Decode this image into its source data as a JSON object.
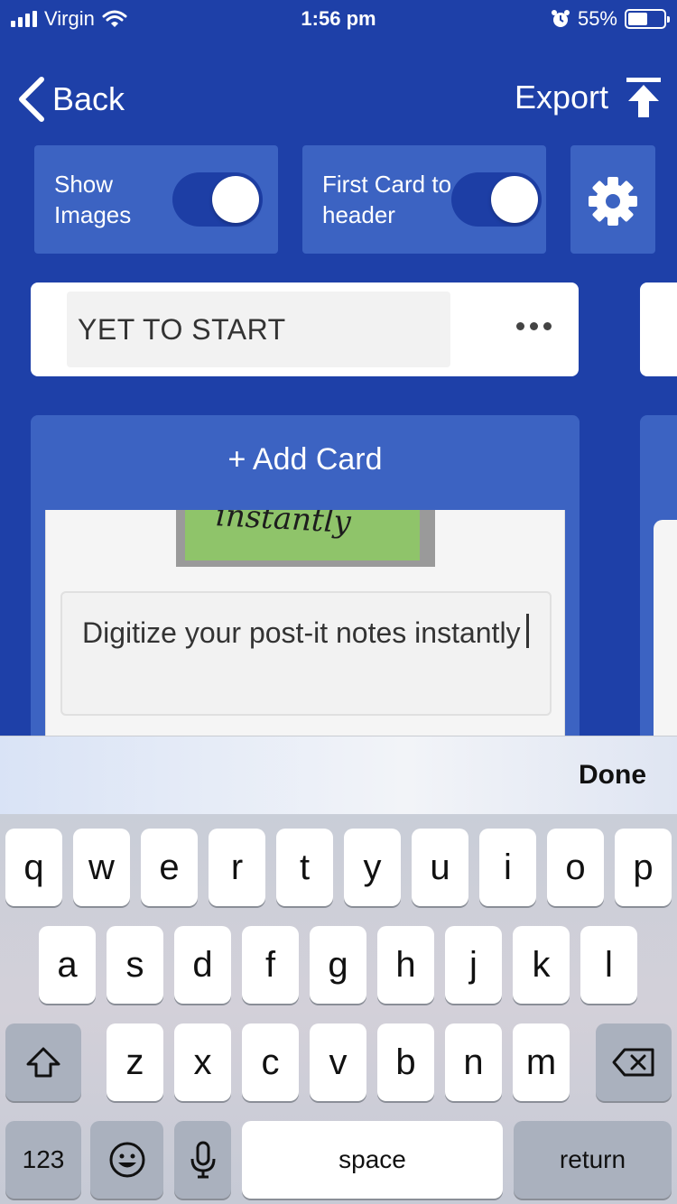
{
  "status_bar": {
    "carrier": "Virgin",
    "time": "1:56 pm",
    "battery_percent": "55%"
  },
  "nav": {
    "back_label": "Back",
    "export_label": "Export"
  },
  "toolbar": {
    "show_images_label": "Show Images",
    "show_images_on": true,
    "first_card_header_label": "First Card to header",
    "first_card_header_on": true
  },
  "column": {
    "title": "YET TO START",
    "add_card_label": "+ Add Card",
    "card": {
      "image_text": "instantly",
      "text": "Digitize your post-it notes instantly"
    }
  },
  "keyboard": {
    "done_label": "Done",
    "row1": [
      "q",
      "w",
      "e",
      "r",
      "t",
      "y",
      "u",
      "i",
      "o",
      "p"
    ],
    "row2": [
      "a",
      "s",
      "d",
      "f",
      "g",
      "h",
      "j",
      "k",
      "l"
    ],
    "row3": [
      "z",
      "x",
      "c",
      "v",
      "b",
      "n",
      "m"
    ],
    "numbers_label": "123",
    "space_label": "space",
    "return_label": "return"
  },
  "colors": {
    "background": "#1e40a8",
    "tile": "#3c63c2",
    "toggle_track": "#1d3ea5"
  }
}
